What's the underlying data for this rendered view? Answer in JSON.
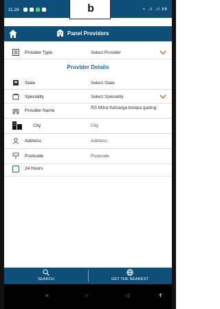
{
  "status_bar": {
    "time": "11.28",
    "right_indicators": "≈ .ıl .ıl 86"
  },
  "annotation_label": "b",
  "header": {
    "title": "Panel Providers"
  },
  "form": {
    "provider_type": {
      "label": "Provider Type",
      "value": "Select Provider"
    },
    "section_title": "Provider Details",
    "state": {
      "label": "State",
      "value": "Select State"
    },
    "speciality": {
      "label": "Speciality",
      "value": "Select Speciality"
    },
    "provider_name": {
      "label": "Provider Name",
      "value": "RS Mitra Keluarga kelapa gading"
    },
    "city": {
      "label": "City",
      "placeholder": "City"
    },
    "address": {
      "label": "Address",
      "placeholder": "Address"
    },
    "postcode": {
      "label": "Postcode",
      "placeholder": "Postcode"
    },
    "hours": {
      "label": "24 Hours"
    }
  },
  "actions": {
    "search_label": "SEARCH",
    "nearest_label": "GET THE NEAREST"
  },
  "colors": {
    "primary": "#0e4f7a",
    "accent": "#1b6aa3",
    "chevron": "#e0541f"
  },
  "icons": [
    "home-icon",
    "provider-icon",
    "list-icon",
    "state-icon",
    "speciality-icon",
    "hospital-icon",
    "city-icon",
    "user-icon",
    "mailbox-icon",
    "search-icon",
    "globe-icon",
    "chevron-down-icon"
  ]
}
